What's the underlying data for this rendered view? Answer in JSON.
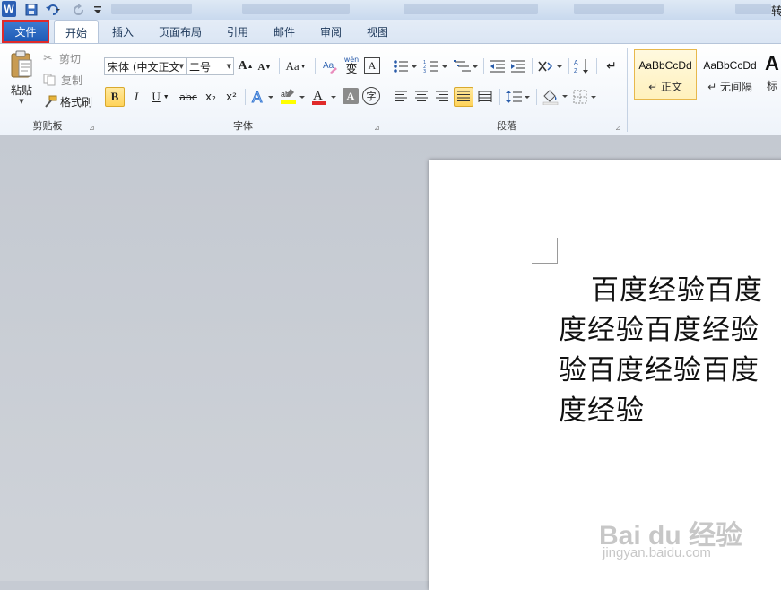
{
  "titlebar": {
    "app_icon": "W",
    "title_fragment": "转"
  },
  "tabs": [
    {
      "label": "文件"
    },
    {
      "label": "开始"
    },
    {
      "label": "插入"
    },
    {
      "label": "页面布局"
    },
    {
      "label": "引用"
    },
    {
      "label": "邮件"
    },
    {
      "label": "审阅"
    },
    {
      "label": "视图"
    }
  ],
  "clipboard": {
    "paste": "粘贴",
    "cut": "剪切",
    "copy": "复制",
    "format_painter": "格式刷",
    "group_label": "剪贴板"
  },
  "font": {
    "font_name": "宋体 (中文正文",
    "font_size": "二号",
    "grow": "A",
    "shrink": "A",
    "change_case": "Aa",
    "bold": "B",
    "italic": "I",
    "underline": "U",
    "strike": "abc",
    "subscript": "x₂",
    "superscript": "x²",
    "font_color": "A",
    "char_shading": "A",
    "enclose": "字",
    "phonetic": "wén",
    "phonetic_char": "变",
    "group_label": "字体"
  },
  "paragraph": {
    "group_label": "段落"
  },
  "styles": [
    {
      "sample": "AaBbCcDd",
      "name": "↵ 正文"
    },
    {
      "sample": "AaBbCcDd",
      "name": "↵ 无间隔"
    },
    {
      "sample": "A",
      "name": "标"
    }
  ],
  "document": {
    "lines": [
      "百度经验百度",
      "度经验百度经验",
      "验百度经验百度",
      "度经验"
    ]
  },
  "watermark": {
    "brand": "Bai du 经验",
    "url": "jingyan.baidu.com"
  },
  "colors": {
    "accent_blue": "#2b5fb4",
    "file_tab_highlight": "#e02a2a",
    "selected_gold": "#ffd35a"
  }
}
